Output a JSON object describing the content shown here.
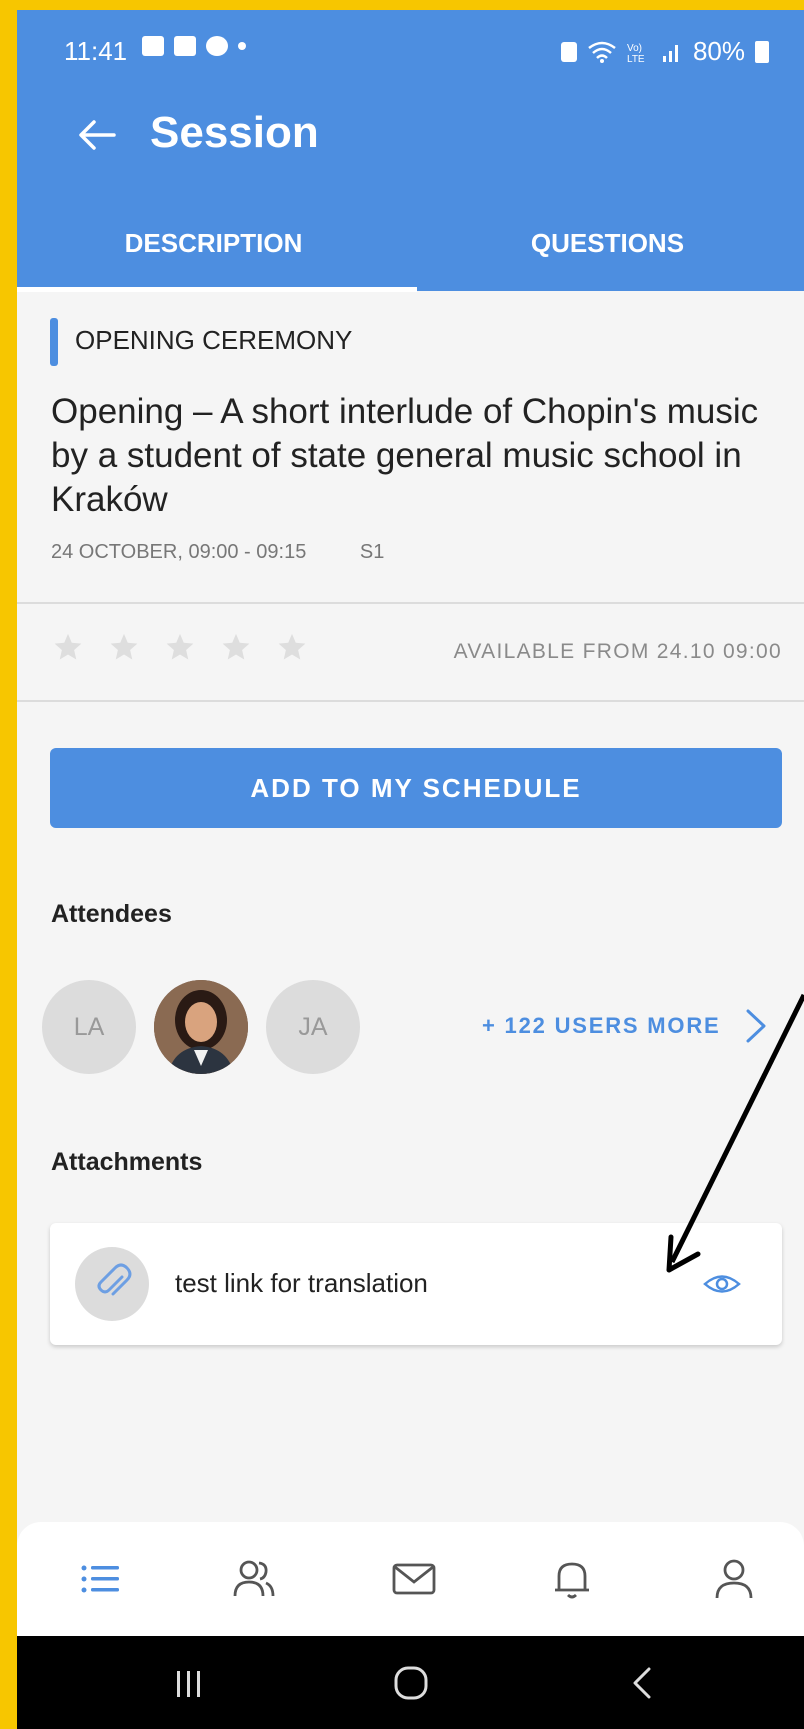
{
  "status_bar": {
    "time": "11:41",
    "battery": "80%"
  },
  "app_bar": {
    "title": "Session"
  },
  "tabs": [
    {
      "label": "DESCRIPTION",
      "active": true
    },
    {
      "label": "QUESTIONS",
      "active": false
    }
  ],
  "session": {
    "category": "OPENING CEREMONY",
    "title": "Opening – A short interlude of Chopin's music by a student of state general music school in Kraków",
    "datetime": "24 OCTOBER, 09:00 - 09:15",
    "room": "S1"
  },
  "rating": {
    "stars": 5,
    "value": 0,
    "availability": "AVAILABLE FROM 24.10 09:00"
  },
  "schedule_button": {
    "label": "ADD TO MY SCHEDULE"
  },
  "attendees": {
    "label": "Attendees",
    "avatars": [
      {
        "initials": "LA"
      },
      {
        "initials": ""
      },
      {
        "initials": "JA"
      }
    ],
    "more_label": "+ 122 USERS MORE"
  },
  "attachments": {
    "label": "Attachments",
    "items": [
      {
        "name": "test link for translation"
      }
    ]
  },
  "colors": {
    "accent": "#4d8ee0",
    "frame": "#f7c600",
    "background": "#f5f5f5"
  },
  "bottom_nav": [
    "list-icon",
    "people-icon",
    "mail-icon",
    "bell-icon",
    "profile-icon"
  ]
}
